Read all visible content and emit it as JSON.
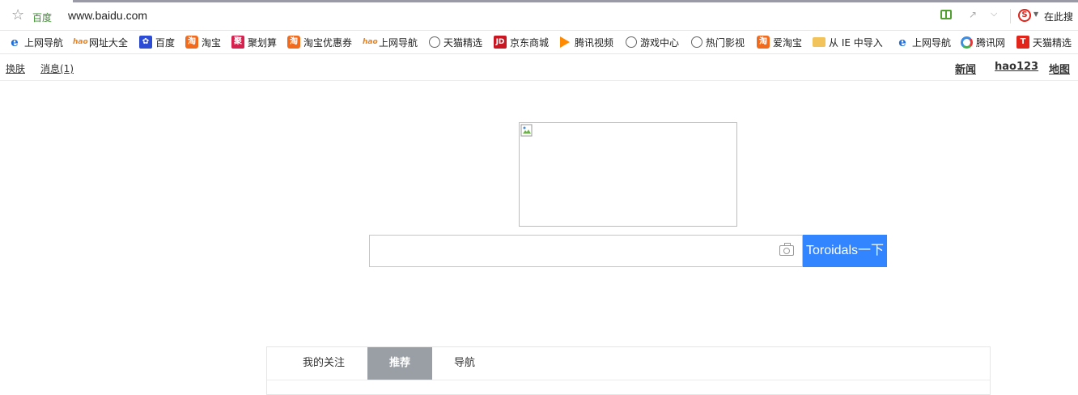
{
  "browser": {
    "site_name": "百度",
    "url": "www.baidu.com",
    "search_here": "在此搜"
  },
  "bookmarks": [
    {
      "label": "上网导航",
      "icon": "ie-icon"
    },
    {
      "label": "网址大全",
      "icon": "hao-icon"
    },
    {
      "label": "百度",
      "icon": "baidu-paw-icon"
    },
    {
      "label": "淘宝",
      "icon": "taobao-icon"
    },
    {
      "label": "聚划算",
      "icon": "juhuasuan-icon"
    },
    {
      "label": "淘宝优惠券",
      "icon": "taobao-icon"
    },
    {
      "label": "上网导航",
      "icon": "hao-icon"
    },
    {
      "label": "天猫精选",
      "icon": "globe-icon"
    },
    {
      "label": "京东商城",
      "icon": "jd-icon"
    },
    {
      "label": "腾讯视频",
      "icon": "tencent-video-icon"
    },
    {
      "label": "游戏中心",
      "icon": "globe-icon"
    },
    {
      "label": "热门影视",
      "icon": "globe-icon"
    },
    {
      "label": "爱淘宝",
      "icon": "taobao-icon"
    },
    {
      "label": "从 IE 中导入",
      "icon": "folder-icon"
    },
    {
      "label": "上网导航",
      "icon": "ie-icon"
    },
    {
      "label": "腾讯网",
      "icon": "qq-icon"
    },
    {
      "label": "天猫精选",
      "icon": "tmall-icon"
    }
  ],
  "icon_glyphs": {
    "taobao": "淘",
    "juhuasuan": "聚",
    "jd": "JD",
    "tmall": "T",
    "ie": "e",
    "hao": "hao"
  },
  "subbar": {
    "skin": "换肤",
    "messages": "消息(1)",
    "news": "新闻",
    "hao123": "hao123",
    "map": "地图"
  },
  "search": {
    "value": "",
    "button_label": "Toroidals一下"
  },
  "tabs": [
    {
      "label": "我的关注",
      "active": false
    },
    {
      "label": "推荐",
      "active": true
    },
    {
      "label": "导航",
      "active": false
    }
  ],
  "colors": {
    "accent": "#3385ff",
    "active_tab": "#9a9fa6"
  }
}
